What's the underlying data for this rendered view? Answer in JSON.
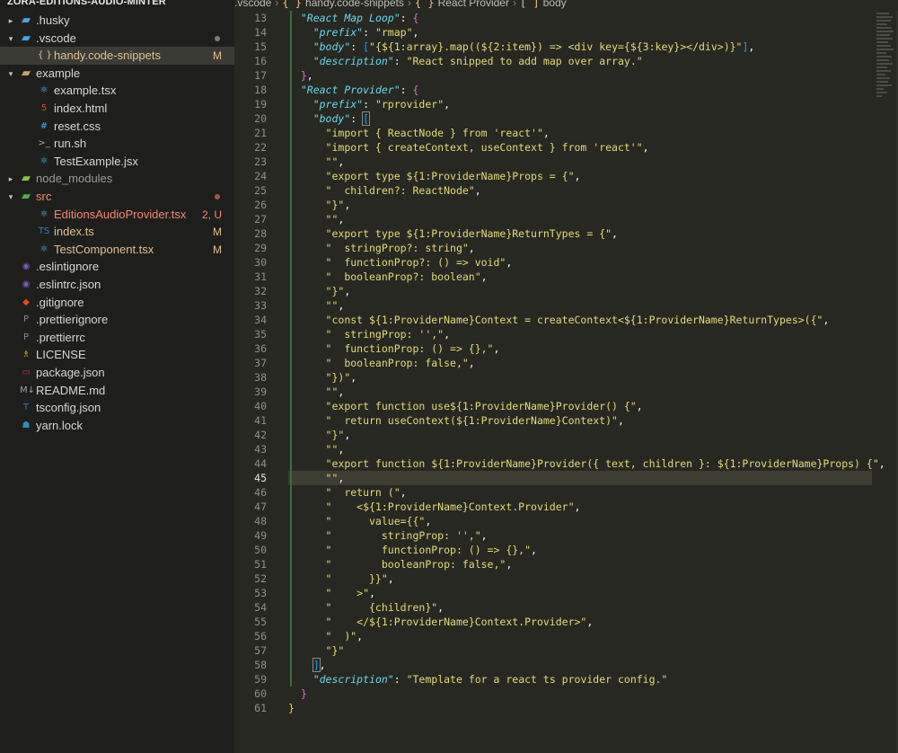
{
  "explorer": {
    "root_label": "ZORA-EDITIONS-AUDIO-MINTER",
    "items": [
      {
        "name": ".husky",
        "kind": "folder",
        "depth": 0,
        "expanded": false,
        "icon": "folder-icon",
        "icon_glyph": "▰",
        "icon_color": "#4aa5f0",
        "status": ""
      },
      {
        "name": ".vscode",
        "kind": "folder",
        "depth": 0,
        "expanded": true,
        "icon": "vscode-folder-icon",
        "icon_glyph": "▰",
        "icon_color": "#3ea6ff",
        "status": "",
        "dot": true
      },
      {
        "name": "handy.code-snippets",
        "kind": "file",
        "depth": 1,
        "icon": "braces-icon",
        "icon_glyph": "{ }",
        "icon_color": "#e2c08d",
        "status": "M",
        "selected": true,
        "style": "mod"
      },
      {
        "name": "example",
        "kind": "folder",
        "depth": 0,
        "expanded": true,
        "icon": "open-folder-icon",
        "icon_glyph": "▰",
        "icon_color": "#c9a26b",
        "status": ""
      },
      {
        "name": "example.tsx",
        "kind": "file",
        "depth": 1,
        "icon": "react-icon",
        "icon_glyph": "⚛",
        "icon_color": "#4fc3f7",
        "status": ""
      },
      {
        "name": "index.html",
        "kind": "file",
        "depth": 1,
        "icon": "html-icon",
        "icon_glyph": "5",
        "icon_color": "#e44d26",
        "status": ""
      },
      {
        "name": "reset.css",
        "kind": "file",
        "depth": 1,
        "icon": "css-icon",
        "icon_glyph": "#",
        "icon_color": "#42a5f5",
        "status": ""
      },
      {
        "name": "run.sh",
        "kind": "file",
        "depth": 1,
        "icon": "terminal-icon",
        "icon_glyph": ">_",
        "icon_color": "#a8a8a8",
        "status": ""
      },
      {
        "name": "TestExample.jsx",
        "kind": "file",
        "depth": 1,
        "icon": "react-icon",
        "icon_glyph": "⚛",
        "icon_color": "#4fc3f7",
        "status": ""
      },
      {
        "name": "node_modules",
        "kind": "folder",
        "depth": 0,
        "expanded": false,
        "icon": "node-folder-icon",
        "icon_glyph": "▰",
        "icon_color": "#8bc34a",
        "status": "",
        "style": "dim"
      },
      {
        "name": "src",
        "kind": "folder",
        "depth": 0,
        "expanded": true,
        "icon": "src-folder-icon",
        "icon_glyph": "▰",
        "icon_color": "#4caf50",
        "status": "",
        "dot": true,
        "dot_err": true,
        "style": "accent"
      },
      {
        "name": "EditionsAudioProvider.tsx",
        "kind": "file",
        "depth": 1,
        "icon": "react-icon",
        "icon_glyph": "⚛",
        "icon_color": "#4fc3f7",
        "status": "2, U",
        "status_err": true,
        "style": "err"
      },
      {
        "name": "index.ts",
        "kind": "file",
        "depth": 1,
        "icon": "typescript-icon",
        "icon_glyph": "TS",
        "icon_color": "#3178c6",
        "status": "M",
        "style": "mod"
      },
      {
        "name": "TestComponent.tsx",
        "kind": "file",
        "depth": 1,
        "icon": "react-icon",
        "icon_glyph": "⚛",
        "icon_color": "#4fc3f7",
        "status": "M",
        "style": "mod"
      },
      {
        "name": ".eslintignore",
        "kind": "file",
        "depth": 0,
        "icon": "eslint-icon",
        "icon_glyph": "◉",
        "icon_color": "#7e57c2",
        "status": ""
      },
      {
        "name": ".eslintrc.json",
        "kind": "file",
        "depth": 0,
        "icon": "eslint-icon",
        "icon_glyph": "◉",
        "icon_color": "#7e57c2",
        "status": ""
      },
      {
        "name": ".gitignore",
        "kind": "file",
        "depth": 0,
        "icon": "git-icon",
        "icon_glyph": "◆",
        "icon_color": "#e64a19",
        "status": ""
      },
      {
        "name": ".prettierignore",
        "kind": "file",
        "depth": 0,
        "icon": "prettier-icon",
        "icon_glyph": "P",
        "icon_color": "#8a8a8a",
        "status": ""
      },
      {
        "name": ".prettierrc",
        "kind": "file",
        "depth": 0,
        "icon": "prettier-icon",
        "icon_glyph": "P",
        "icon_color": "#8a8a8a",
        "status": ""
      },
      {
        "name": "LICENSE",
        "kind": "file",
        "depth": 0,
        "icon": "license-icon",
        "icon_glyph": "♗",
        "icon_color": "#f5a623",
        "status": ""
      },
      {
        "name": "package.json",
        "kind": "file",
        "depth": 0,
        "icon": "npm-icon",
        "icon_glyph": "▭",
        "icon_color": "#cb3837",
        "status": ""
      },
      {
        "name": "README.md",
        "kind": "file",
        "depth": 0,
        "icon": "markdown-icon",
        "icon_glyph": "M↓",
        "icon_color": "#9aa0a6",
        "status": ""
      },
      {
        "name": "tsconfig.json",
        "kind": "file",
        "depth": 0,
        "icon": "tsconfig-icon",
        "icon_glyph": "T",
        "icon_color": "#3178c6",
        "status": ""
      },
      {
        "name": "yarn.lock",
        "kind": "file",
        "depth": 0,
        "icon": "yarn-icon",
        "icon_glyph": "☗",
        "icon_color": "#2c8ebb",
        "status": ""
      }
    ]
  },
  "breadcrumb": [
    {
      "label": ".vscode",
      "icon": ""
    },
    {
      "label": "handy.code-snippets",
      "icon": "{ }"
    },
    {
      "label": "React Provider",
      "icon": "{ }"
    },
    {
      "label": "body",
      "icon": "[ ]"
    }
  ],
  "editor": {
    "current_line": 45,
    "lines": [
      {
        "n": 13,
        "g": 1,
        "t": [
          [
            "str-key",
            "\"React Map Loop\""
          ],
          [
            "pun",
            ": "
          ],
          [
            "br2",
            "{"
          ]
        ]
      },
      {
        "n": 14,
        "g": 2,
        "t": [
          [
            "str-key",
            "\"prefix\""
          ],
          [
            "pun",
            ": "
          ],
          [
            "str",
            "\"rmap\""
          ],
          [
            "pun",
            ","
          ]
        ]
      },
      {
        "n": 15,
        "g": 2,
        "t": [
          [
            "str-key",
            "\"body\""
          ],
          [
            "pun",
            ": "
          ],
          [
            "br3",
            "["
          ],
          [
            "str",
            "\"{${1:array}.map((${2:item}) => <div key={${3:key}></div>)}\""
          ],
          [
            "br3",
            "]"
          ],
          [
            "pun",
            ","
          ]
        ]
      },
      {
        "n": 16,
        "g": 2,
        "t": [
          [
            "str-key",
            "\"description\""
          ],
          [
            "pun",
            ": "
          ],
          [
            "str",
            "\"React snipped to add map over array.\""
          ]
        ]
      },
      {
        "n": 17,
        "g": 1,
        "t": [
          [
            "br2",
            "}"
          ],
          [
            "pun",
            ","
          ]
        ]
      },
      {
        "n": 18,
        "g": 1,
        "t": [
          [
            "str-key",
            "\"React Provider\""
          ],
          [
            "pun",
            ": "
          ],
          [
            "br2",
            "{"
          ]
        ]
      },
      {
        "n": 19,
        "g": 2,
        "t": [
          [
            "str-key",
            "\"prefix\""
          ],
          [
            "pun",
            ": "
          ],
          [
            "str",
            "\"rprovider\""
          ],
          [
            "pun",
            ","
          ]
        ]
      },
      {
        "n": 20,
        "g": 2,
        "t": [
          [
            "str-key",
            "\"body\""
          ],
          [
            "pun",
            ": "
          ],
          [
            "br3c",
            "["
          ]
        ]
      },
      {
        "n": 21,
        "g": 3,
        "t": [
          [
            "str",
            "\"import { ReactNode } from 'react'\""
          ],
          [
            "pun",
            ","
          ]
        ]
      },
      {
        "n": 22,
        "g": 3,
        "t": [
          [
            "str",
            "\"import { createContext, useContext } from 'react'\""
          ],
          [
            "pun",
            ","
          ]
        ]
      },
      {
        "n": 23,
        "g": 3,
        "t": [
          [
            "str",
            "\"\""
          ],
          [
            "pun",
            ","
          ]
        ]
      },
      {
        "n": 24,
        "g": 3,
        "t": [
          [
            "str",
            "\"export type ${1:ProviderName}Props = {\""
          ],
          [
            "pun",
            ","
          ]
        ]
      },
      {
        "n": 25,
        "g": 3,
        "t": [
          [
            "str",
            "\"  children?: ReactNode\""
          ],
          [
            "pun",
            ","
          ]
        ]
      },
      {
        "n": 26,
        "g": 3,
        "t": [
          [
            "str",
            "\"}\""
          ],
          [
            "pun",
            ","
          ]
        ]
      },
      {
        "n": 27,
        "g": 3,
        "t": [
          [
            "str",
            "\"\""
          ],
          [
            "pun",
            ","
          ]
        ]
      },
      {
        "n": 28,
        "g": 3,
        "t": [
          [
            "str",
            "\"export type ${1:ProviderName}ReturnTypes = {\""
          ],
          [
            "pun",
            ","
          ]
        ]
      },
      {
        "n": 29,
        "g": 3,
        "t": [
          [
            "str",
            "\"  stringProp?: string\""
          ],
          [
            "pun",
            ","
          ]
        ]
      },
      {
        "n": 30,
        "g": 3,
        "t": [
          [
            "str",
            "\"  functionProp?: () => void\""
          ],
          [
            "pun",
            ","
          ]
        ]
      },
      {
        "n": 31,
        "g": 3,
        "t": [
          [
            "str",
            "\"  booleanProp?: boolean\""
          ],
          [
            "pun",
            ","
          ]
        ]
      },
      {
        "n": 32,
        "g": 3,
        "t": [
          [
            "str",
            "\"}\""
          ],
          [
            "pun",
            ","
          ]
        ]
      },
      {
        "n": 33,
        "g": 3,
        "t": [
          [
            "str",
            "\"\""
          ],
          [
            "pun",
            ","
          ]
        ]
      },
      {
        "n": 34,
        "g": 3,
        "t": [
          [
            "str",
            "\"const ${1:ProviderName}Context = createContext<${1:ProviderName}ReturnTypes>({\""
          ],
          [
            "pun",
            ","
          ]
        ]
      },
      {
        "n": 35,
        "g": 3,
        "t": [
          [
            "str",
            "\"  stringProp: '',\""
          ],
          [
            "pun",
            ","
          ]
        ]
      },
      {
        "n": 36,
        "g": 3,
        "t": [
          [
            "str",
            "\"  functionProp: () => {},\""
          ],
          [
            "pun",
            ","
          ]
        ]
      },
      {
        "n": 37,
        "g": 3,
        "t": [
          [
            "str",
            "\"  booleanProp: false,\""
          ],
          [
            "pun",
            ","
          ]
        ]
      },
      {
        "n": 38,
        "g": 3,
        "t": [
          [
            "str",
            "\"})\""
          ],
          [
            "pun",
            ","
          ]
        ]
      },
      {
        "n": 39,
        "g": 3,
        "t": [
          [
            "str",
            "\"\""
          ],
          [
            "pun",
            ","
          ]
        ]
      },
      {
        "n": 40,
        "g": 3,
        "t": [
          [
            "str",
            "\"export function use${1:ProviderName}Provider() {\""
          ],
          [
            "pun",
            ","
          ]
        ]
      },
      {
        "n": 41,
        "g": 3,
        "t": [
          [
            "str",
            "\"  return useContext(${1:ProviderName}Context)\""
          ],
          [
            "pun",
            ","
          ]
        ]
      },
      {
        "n": 42,
        "g": 3,
        "t": [
          [
            "str",
            "\"}\""
          ],
          [
            "pun",
            ","
          ]
        ]
      },
      {
        "n": 43,
        "g": 3,
        "t": [
          [
            "str",
            "\"\""
          ],
          [
            "pun",
            ","
          ]
        ]
      },
      {
        "n": 44,
        "g": 3,
        "t": [
          [
            "str",
            "\"export function ${1:ProviderName}Provider({ text, children }: ${1:ProviderName}Props) {\""
          ],
          [
            "pun",
            ","
          ]
        ]
      },
      {
        "n": 45,
        "g": 3,
        "t": [
          [
            "str",
            "\"\""
          ],
          [
            "pun",
            ","
          ]
        ]
      },
      {
        "n": 46,
        "g": 3,
        "t": [
          [
            "str",
            "\"  return (\""
          ],
          [
            "pun",
            ","
          ]
        ]
      },
      {
        "n": 47,
        "g": 3,
        "t": [
          [
            "str",
            "\"    <${1:ProviderName}Context.Provider\""
          ],
          [
            "pun",
            ","
          ]
        ]
      },
      {
        "n": 48,
        "g": 3,
        "t": [
          [
            "str",
            "\"      value={{\""
          ],
          [
            "pun",
            ","
          ]
        ]
      },
      {
        "n": 49,
        "g": 3,
        "t": [
          [
            "str",
            "\"        stringProp: '',\""
          ],
          [
            "pun",
            ","
          ]
        ]
      },
      {
        "n": 50,
        "g": 3,
        "t": [
          [
            "str",
            "\"        functionProp: () => {},\""
          ],
          [
            "pun",
            ","
          ]
        ]
      },
      {
        "n": 51,
        "g": 3,
        "t": [
          [
            "str",
            "\"        booleanProp: false,\""
          ],
          [
            "pun",
            ","
          ]
        ]
      },
      {
        "n": 52,
        "g": 3,
        "t": [
          [
            "str",
            "\"      }}\""
          ],
          [
            "pun",
            ","
          ]
        ]
      },
      {
        "n": 53,
        "g": 3,
        "t": [
          [
            "str",
            "\"    >\""
          ],
          [
            "pun",
            ","
          ]
        ]
      },
      {
        "n": 54,
        "g": 3,
        "t": [
          [
            "str",
            "\"      {children}\""
          ],
          [
            "pun",
            ","
          ]
        ]
      },
      {
        "n": 55,
        "g": 3,
        "t": [
          [
            "str",
            "\"    </${1:ProviderName}Context.Provider>\""
          ],
          [
            "pun",
            ","
          ]
        ]
      },
      {
        "n": 56,
        "g": 3,
        "t": [
          [
            "str",
            "\"  )\""
          ],
          [
            "pun",
            ","
          ]
        ]
      },
      {
        "n": 57,
        "g": 3,
        "t": [
          [
            "str",
            "\"}\""
          ]
        ]
      },
      {
        "n": 58,
        "g": 2,
        "t": [
          [
            "br3c",
            "]"
          ],
          [
            "pun",
            ","
          ]
        ]
      },
      {
        "n": 59,
        "g": 2,
        "t": [
          [
            "str-key",
            "\"description\""
          ],
          [
            "pun",
            ": "
          ],
          [
            "str",
            "\"Template for a react ts provider config.\""
          ]
        ]
      },
      {
        "n": 60,
        "g": 1,
        "t": [
          [
            "br2",
            "}"
          ]
        ]
      },
      {
        "n": 61,
        "g": 0,
        "t": [
          [
            "br1",
            "}"
          ]
        ]
      }
    ]
  },
  "colors": {
    "editor_bg": "#272822",
    "sidebar_bg": "#1e1f1c",
    "selected_bg": "#3a3b35",
    "string": "#e6db74",
    "key": "#66d9ef",
    "modified": "#e2c08d",
    "error": "#f48771"
  }
}
